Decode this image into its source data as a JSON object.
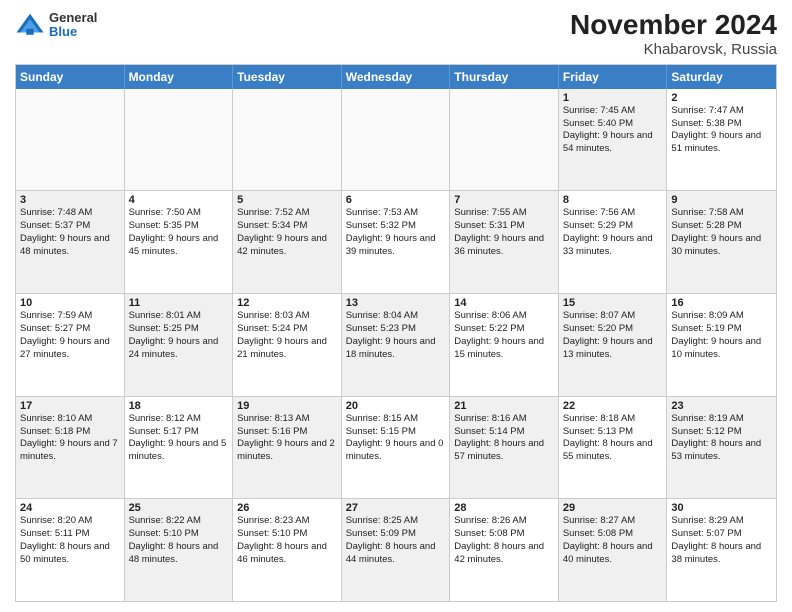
{
  "logo": {
    "general": "General",
    "blue": "Blue"
  },
  "title": "November 2024",
  "subtitle": "Khabarovsk, Russia",
  "days_header": [
    "Sunday",
    "Monday",
    "Tuesday",
    "Wednesday",
    "Thursday",
    "Friday",
    "Saturday"
  ],
  "rows": [
    [
      {
        "day": "",
        "info": "",
        "empty": true
      },
      {
        "day": "",
        "info": "",
        "empty": true
      },
      {
        "day": "",
        "info": "",
        "empty": true
      },
      {
        "day": "",
        "info": "",
        "empty": true
      },
      {
        "day": "",
        "info": "",
        "empty": true
      },
      {
        "day": "1",
        "info": "Sunrise: 7:45 AM\nSunset: 5:40 PM\nDaylight: 9 hours and 54 minutes.",
        "shaded": true
      },
      {
        "day": "2",
        "info": "Sunrise: 7:47 AM\nSunset: 5:38 PM\nDaylight: 9 hours and 51 minutes.",
        "shaded": false
      }
    ],
    [
      {
        "day": "3",
        "info": "Sunrise: 7:48 AM\nSunset: 5:37 PM\nDaylight: 9 hours and 48 minutes.",
        "shaded": true
      },
      {
        "day": "4",
        "info": "Sunrise: 7:50 AM\nSunset: 5:35 PM\nDaylight: 9 hours and 45 minutes.",
        "shaded": false
      },
      {
        "day": "5",
        "info": "Sunrise: 7:52 AM\nSunset: 5:34 PM\nDaylight: 9 hours and 42 minutes.",
        "shaded": true
      },
      {
        "day": "6",
        "info": "Sunrise: 7:53 AM\nSunset: 5:32 PM\nDaylight: 9 hours and 39 minutes.",
        "shaded": false
      },
      {
        "day": "7",
        "info": "Sunrise: 7:55 AM\nSunset: 5:31 PM\nDaylight: 9 hours and 36 minutes.",
        "shaded": true
      },
      {
        "day": "8",
        "info": "Sunrise: 7:56 AM\nSunset: 5:29 PM\nDaylight: 9 hours and 33 minutes.",
        "shaded": false
      },
      {
        "day": "9",
        "info": "Sunrise: 7:58 AM\nSunset: 5:28 PM\nDaylight: 9 hours and 30 minutes.",
        "shaded": true
      }
    ],
    [
      {
        "day": "10",
        "info": "Sunrise: 7:59 AM\nSunset: 5:27 PM\nDaylight: 9 hours and 27 minutes.",
        "shaded": false
      },
      {
        "day": "11",
        "info": "Sunrise: 8:01 AM\nSunset: 5:25 PM\nDaylight: 9 hours and 24 minutes.",
        "shaded": true
      },
      {
        "day": "12",
        "info": "Sunrise: 8:03 AM\nSunset: 5:24 PM\nDaylight: 9 hours and 21 minutes.",
        "shaded": false
      },
      {
        "day": "13",
        "info": "Sunrise: 8:04 AM\nSunset: 5:23 PM\nDaylight: 9 hours and 18 minutes.",
        "shaded": true
      },
      {
        "day": "14",
        "info": "Sunrise: 8:06 AM\nSunset: 5:22 PM\nDaylight: 9 hours and 15 minutes.",
        "shaded": false
      },
      {
        "day": "15",
        "info": "Sunrise: 8:07 AM\nSunset: 5:20 PM\nDaylight: 9 hours and 13 minutes.",
        "shaded": true
      },
      {
        "day": "16",
        "info": "Sunrise: 8:09 AM\nSunset: 5:19 PM\nDaylight: 9 hours and 10 minutes.",
        "shaded": false
      }
    ],
    [
      {
        "day": "17",
        "info": "Sunrise: 8:10 AM\nSunset: 5:18 PM\nDaylight: 9 hours and 7 minutes.",
        "shaded": true
      },
      {
        "day": "18",
        "info": "Sunrise: 8:12 AM\nSunset: 5:17 PM\nDaylight: 9 hours and 5 minutes.",
        "shaded": false
      },
      {
        "day": "19",
        "info": "Sunrise: 8:13 AM\nSunset: 5:16 PM\nDaylight: 9 hours and 2 minutes.",
        "shaded": true
      },
      {
        "day": "20",
        "info": "Sunrise: 8:15 AM\nSunset: 5:15 PM\nDaylight: 9 hours and 0 minutes.",
        "shaded": false
      },
      {
        "day": "21",
        "info": "Sunrise: 8:16 AM\nSunset: 5:14 PM\nDaylight: 8 hours and 57 minutes.",
        "shaded": true
      },
      {
        "day": "22",
        "info": "Sunrise: 8:18 AM\nSunset: 5:13 PM\nDaylight: 8 hours and 55 minutes.",
        "shaded": false
      },
      {
        "day": "23",
        "info": "Sunrise: 8:19 AM\nSunset: 5:12 PM\nDaylight: 8 hours and 53 minutes.",
        "shaded": true
      }
    ],
    [
      {
        "day": "24",
        "info": "Sunrise: 8:20 AM\nSunset: 5:11 PM\nDaylight: 8 hours and 50 minutes.",
        "shaded": false
      },
      {
        "day": "25",
        "info": "Sunrise: 8:22 AM\nSunset: 5:10 PM\nDaylight: 8 hours and 48 minutes.",
        "shaded": true
      },
      {
        "day": "26",
        "info": "Sunrise: 8:23 AM\nSunset: 5:10 PM\nDaylight: 8 hours and 46 minutes.",
        "shaded": false
      },
      {
        "day": "27",
        "info": "Sunrise: 8:25 AM\nSunset: 5:09 PM\nDaylight: 8 hours and 44 minutes.",
        "shaded": true
      },
      {
        "day": "28",
        "info": "Sunrise: 8:26 AM\nSunset: 5:08 PM\nDaylight: 8 hours and 42 minutes.",
        "shaded": false
      },
      {
        "day": "29",
        "info": "Sunrise: 8:27 AM\nSunset: 5:08 PM\nDaylight: 8 hours and 40 minutes.",
        "shaded": true
      },
      {
        "day": "30",
        "info": "Sunrise: 8:29 AM\nSunset: 5:07 PM\nDaylight: 8 hours and 38 minutes.",
        "shaded": false
      }
    ]
  ]
}
